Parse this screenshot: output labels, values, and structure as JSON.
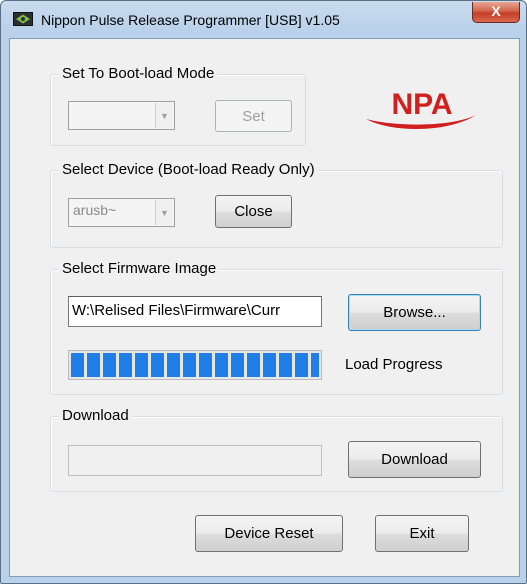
{
  "window": {
    "title": "Nippon Pulse Release Programmer [USB] v1.05",
    "close_label": "X"
  },
  "boot_mode": {
    "label": "Set To Boot-load Mode",
    "combo_value": "",
    "set_label": "Set"
  },
  "logo": {
    "text": "NPA",
    "color": "#d11f1f"
  },
  "device": {
    "label": "Select Device (Boot-load Ready Only)",
    "combo_value": "arusb~",
    "close_label": "Close"
  },
  "firmware": {
    "label": "Select Firmware Image",
    "path": "W:\\Relised Files\\Firmware\\Curr",
    "browse_label": "Browse...",
    "progress_label": "Load Progress",
    "progress_fraction": 1.0
  },
  "download": {
    "label": "Download",
    "field_value": "",
    "download_label": "Download"
  },
  "footer": {
    "reset_label": "Device Reset",
    "exit_label": "Exit"
  },
  "colors": {
    "progress": "#1f7ee8",
    "titlebar": "#b9d1ea",
    "close_button": "#c23f26"
  },
  "icons": {
    "app_icon": "app-icon",
    "combo_arrow": "chevron-down-icon"
  }
}
